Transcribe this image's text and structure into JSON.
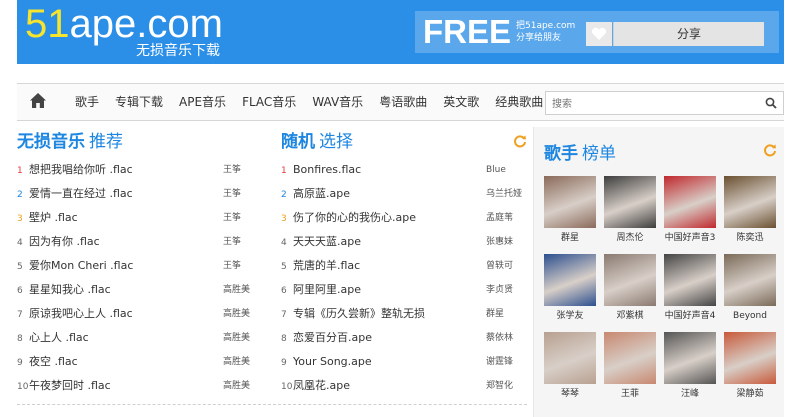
{
  "header": {
    "logo_prefix": "51",
    "logo_rest": "ape.com",
    "tagline": "无损音乐下载",
    "free": "FREE",
    "free_sub_line1": "把51ape.com",
    "free_sub_line2": "分享给朋友",
    "share_label": "分享"
  },
  "nav": {
    "items": [
      "歌手",
      "专辑下载",
      "APE音乐",
      "FLAC音乐",
      "WAV音乐",
      "粤语歌曲",
      "英文歌",
      "经典歌曲"
    ],
    "search_placeholder": "搜索"
  },
  "list_lossless": {
    "title": "无损音乐",
    "title_sub": "推荐",
    "songs": [
      {
        "rank": "1",
        "title": "想把我唱给你听 .flac",
        "artist": "王筝"
      },
      {
        "rank": "2",
        "title": "爱情一直在经过 .flac",
        "artist": "王筝"
      },
      {
        "rank": "3",
        "title": "壁炉 .flac",
        "artist": "王筝"
      },
      {
        "rank": "4",
        "title": "因为有你 .flac",
        "artist": "王筝"
      },
      {
        "rank": "5",
        "title": "爱你Mon Cheri .flac",
        "artist": "王筝"
      },
      {
        "rank": "6",
        "title": "星星知我心 .flac",
        "artist": "高胜美"
      },
      {
        "rank": "7",
        "title": "原谅我吧心上人 .flac",
        "artist": "高胜美"
      },
      {
        "rank": "8",
        "title": "心上人 .flac",
        "artist": "高胜美"
      },
      {
        "rank": "9",
        "title": "夜空 .flac",
        "artist": "高胜美"
      },
      {
        "rank": "10",
        "title": "午夜梦回时 .flac",
        "artist": "高胜美"
      }
    ]
  },
  "list_random": {
    "title": "随机",
    "title_sub": "选择",
    "songs": [
      {
        "rank": "1",
        "title": "Bonfires.flac",
        "artist": "Blue"
      },
      {
        "rank": "2",
        "title": "高原蓝.ape",
        "artist": "乌兰托娅"
      },
      {
        "rank": "3",
        "title": "伤了你的心的我伤心.ape",
        "artist": "孟庭苇"
      },
      {
        "rank": "4",
        "title": "天天天蓝.ape",
        "artist": "张惠妹"
      },
      {
        "rank": "5",
        "title": "荒唐的羊.flac",
        "artist": "曾轶可"
      },
      {
        "rank": "6",
        "title": "阿里阿里.ape",
        "artist": "李贞贤"
      },
      {
        "rank": "7",
        "title": "专辑《历久尝新》整轨无损",
        "artist": "群星"
      },
      {
        "rank": "8",
        "title": "恋爱百分百.ape",
        "artist": "蔡依林"
      },
      {
        "rank": "9",
        "title": "Your Song.ape",
        "artist": "谢霆锋"
      },
      {
        "rank": "10",
        "title": "凤凰花.ape",
        "artist": "郑智化"
      }
    ]
  },
  "ranking": {
    "title": "歌手",
    "title_sub": "榜单",
    "artists": [
      {
        "name": "群星",
        "color": "#8a6a5a"
      },
      {
        "name": "周杰伦",
        "color": "#3d3d3d"
      },
      {
        "name": "中国好声音3",
        "color": "#c0282d"
      },
      {
        "name": "陈奕迅",
        "color": "#6a5030"
      },
      {
        "name": "张学友",
        "color": "#2c4f8f"
      },
      {
        "name": "邓紫棋",
        "color": "#8a7a70"
      },
      {
        "name": "中国好声音4",
        "color": "#444444"
      },
      {
        "name": "Beyond",
        "color": "#7a6a58"
      },
      {
        "name": "琴琴",
        "color": "#b8a090"
      },
      {
        "name": "王菲",
        "color": "#c88870"
      },
      {
        "name": "汪峰",
        "color": "#555555"
      },
      {
        "name": "梁静茹",
        "color": "#c85a3a"
      }
    ]
  }
}
